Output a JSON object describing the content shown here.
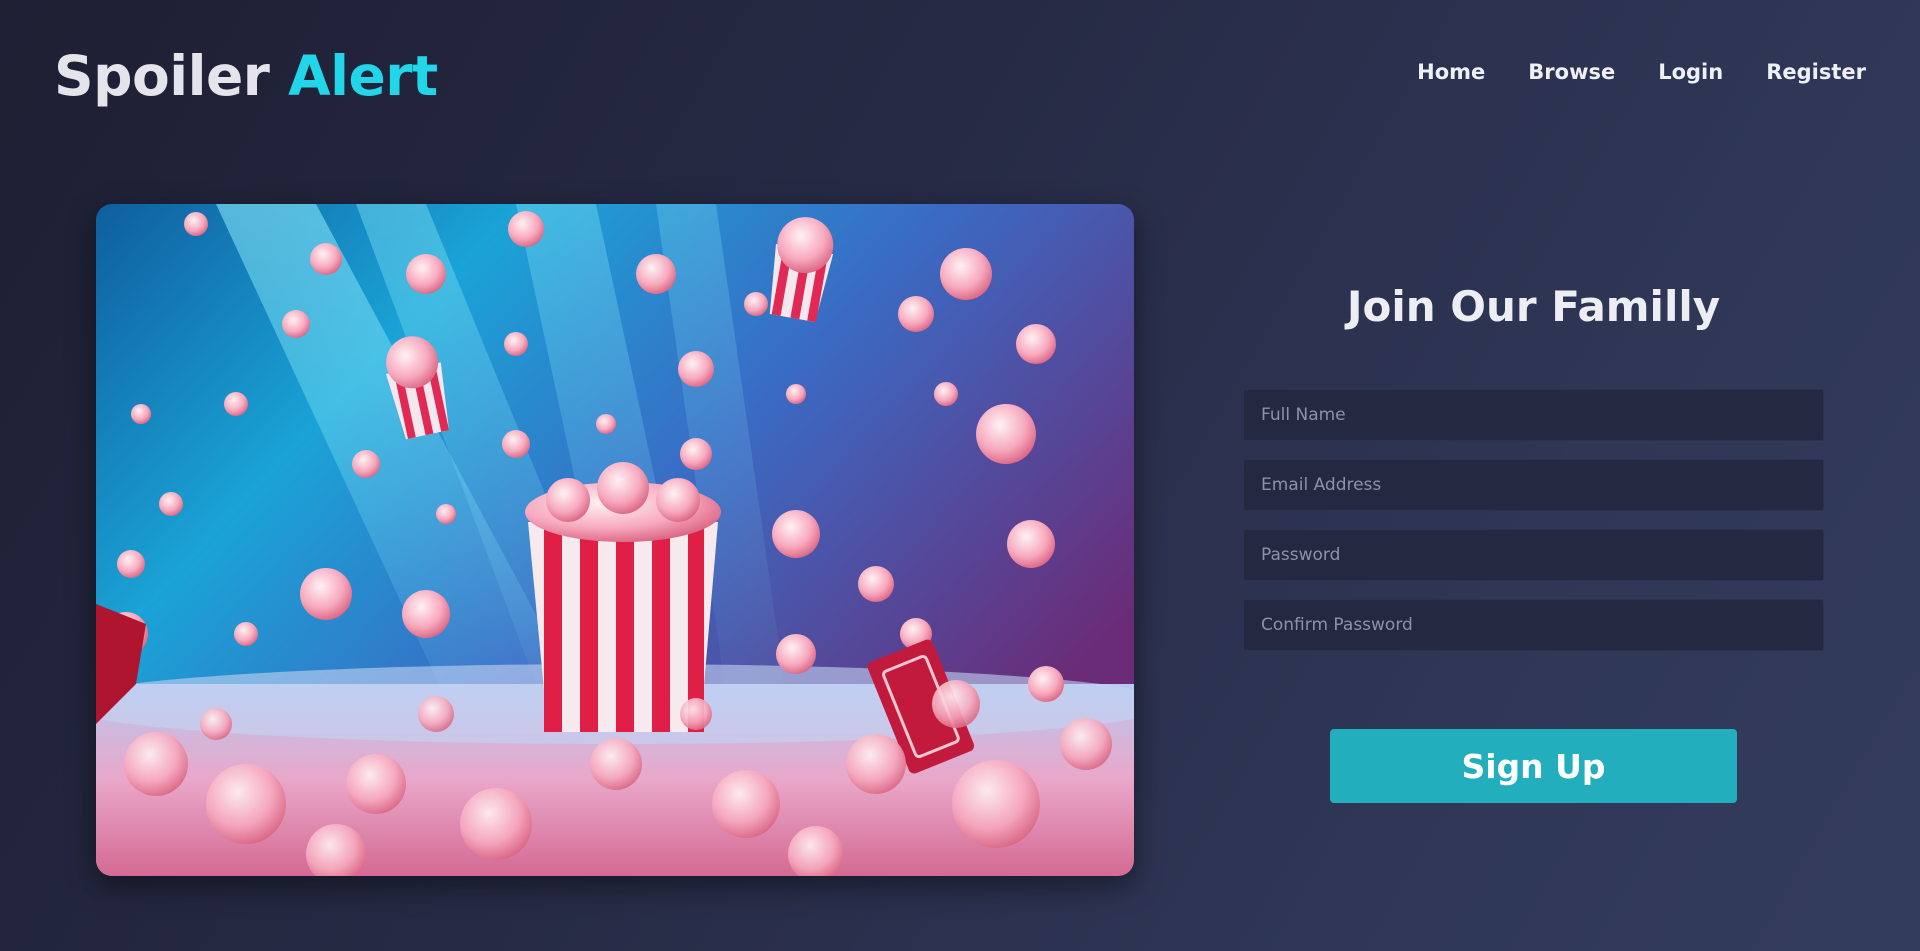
{
  "brand": {
    "name_part1": "Spoiler",
    "name_part2": "Alert",
    "accent_color": "#22d6ea"
  },
  "nav": {
    "items": [
      {
        "label": "Home"
      },
      {
        "label": "Browse"
      },
      {
        "label": "Login"
      },
      {
        "label": "Register"
      }
    ]
  },
  "hero": {
    "image_subject": "popcorn-cinema-image"
  },
  "signup": {
    "title": "Join Our Familly",
    "fields": {
      "full_name": {
        "placeholder": "Full Name",
        "value": ""
      },
      "email": {
        "placeholder": "Email Address",
        "value": ""
      },
      "password": {
        "placeholder": "Password",
        "value": ""
      },
      "confirm_password": {
        "placeholder": "Confirm Password",
        "value": ""
      }
    },
    "submit_label": "Sign Up",
    "button_color": "#22aebd"
  }
}
